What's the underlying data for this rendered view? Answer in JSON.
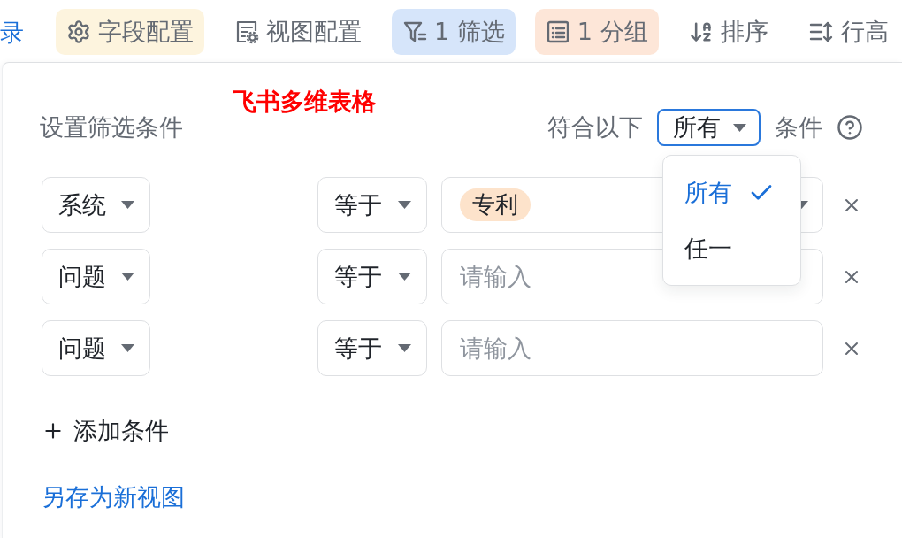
{
  "toolbar": {
    "partial_tab": "录",
    "buttons": [
      {
        "label": "字段配置",
        "active": true,
        "color": "#fdf4de"
      },
      {
        "label": "视图配置",
        "active": false
      },
      {
        "label": "1 筛选",
        "active": true,
        "color": "#d6e5fa"
      },
      {
        "label": "1 分组",
        "active": true,
        "color": "#fde6d8"
      },
      {
        "label": "排序",
        "active": false
      },
      {
        "label": "行高",
        "active": false
      }
    ]
  },
  "filter_panel": {
    "annotation": "飞书多维表格",
    "title": "设置筛选条件",
    "match_prefix": "符合以下",
    "match_select": {
      "value": "所有",
      "open": true
    },
    "match_suffix": "条件",
    "match_menu": [
      {
        "label": "所有",
        "selected": true
      },
      {
        "label": "任一",
        "selected": false
      }
    ],
    "conditions": [
      {
        "field": "系统",
        "operator": "等于",
        "kind": "tags",
        "tags": [
          {
            "label": "专利",
            "color": "#fde3cb"
          }
        ]
      },
      {
        "field": "问题",
        "operator": "等于",
        "kind": "text",
        "placeholder": "请输入"
      },
      {
        "field": "问题",
        "operator": "等于",
        "kind": "text",
        "placeholder": "请输入"
      }
    ],
    "add_condition": "添加条件",
    "save_as_view": "另存为新视图"
  }
}
